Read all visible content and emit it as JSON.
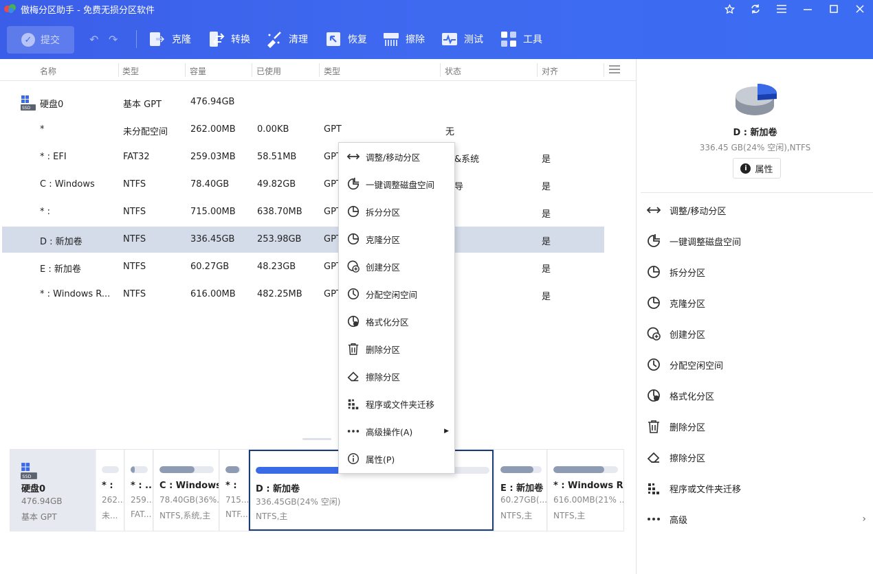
{
  "app": {
    "title": "傲梅分区助手 - 免费无损分区软件"
  },
  "window_buttons": [
    "star-icon",
    "refresh-icon",
    "menu-icon",
    "minimize-icon",
    "maximize-icon",
    "close-icon"
  ],
  "toolbar": {
    "submit_label": "提交",
    "tools": [
      {
        "label": "克隆",
        "icon": "clone-icon"
      },
      {
        "label": "转换",
        "icon": "convert-icon"
      },
      {
        "label": "清理",
        "icon": "clean-icon"
      },
      {
        "label": "恢复",
        "icon": "recover-icon"
      },
      {
        "label": "擦除",
        "icon": "wipe-icon"
      },
      {
        "label": "测试",
        "icon": "test-icon"
      },
      {
        "label": "工具",
        "icon": "tools-icon"
      }
    ]
  },
  "table": {
    "headers": [
      "名称",
      "类型",
      "容量",
      "已使用",
      "类型",
      "状态",
      "对齐"
    ],
    "rows": [
      {
        "name": "硬盘0",
        "type": "基本 GPT",
        "capacity": "476.94GB",
        "used": "",
        "ptype": "",
        "status": "",
        "align": "",
        "is_disk": true
      },
      {
        "name": "*",
        "type": "未分配空间",
        "capacity": "262.00MB",
        "used": "0.00KB",
        "ptype": "GPT",
        "status": "无",
        "align": ""
      },
      {
        "name": "* : EFI",
        "type": "FAT32",
        "capacity": "259.03MB",
        "used": "58.51MB",
        "ptype": "GPT",
        "status": "动&系统",
        "align": "是"
      },
      {
        "name": "C : Windows",
        "type": "NTFS",
        "capacity": "78.40GB",
        "used": "49.82GB",
        "ptype": "GPT",
        "status": "导",
        "align": "是"
      },
      {
        "name": "* :",
        "type": "NTFS",
        "capacity": "715.00MB",
        "used": "638.70MB",
        "ptype": "GPT",
        "status": "",
        "align": "是"
      },
      {
        "name": "D : 新加卷",
        "type": "NTFS",
        "capacity": "336.45GB",
        "used": "253.98GB",
        "ptype": "GPT",
        "status": "",
        "align": "是",
        "selected": true
      },
      {
        "name": "E : 新加卷",
        "type": "NTFS",
        "capacity": "60.27GB",
        "used": "48.23GB",
        "ptype": "GPT",
        "status": "",
        "align": "是"
      },
      {
        "name": "* : Windows R...",
        "type": "NTFS",
        "capacity": "616.00MB",
        "used": "482.25MB",
        "ptype": "GPT",
        "status": "",
        "align": "是"
      }
    ]
  },
  "context_menu": {
    "items": [
      {
        "label": "调整/移动分区",
        "icon": "resize-move-icon"
      },
      {
        "label": "一键调整磁盘空间",
        "icon": "quick-adjust-icon"
      },
      {
        "label": "拆分分区",
        "icon": "split-icon"
      },
      {
        "label": "克隆分区",
        "icon": "clone-partition-icon"
      },
      {
        "label": "创建分区",
        "icon": "create-partition-icon"
      },
      {
        "label": "分配空闲空间",
        "icon": "allocate-space-icon"
      },
      {
        "label": "格式化分区",
        "icon": "format-icon"
      },
      {
        "label": "删除分区",
        "icon": "delete-icon"
      },
      {
        "label": "擦除分区",
        "icon": "erase-icon"
      },
      {
        "label": "程序或文件夹迁移",
        "icon": "migrate-icon"
      },
      {
        "label": "高级操作(A)",
        "icon": "more-icon",
        "submenu": true
      },
      {
        "label": "属性(P)",
        "icon": "info-icon"
      }
    ]
  },
  "disk_map": {
    "disk": {
      "name": "硬盘0",
      "size": "476.94GB",
      "type": "基本 GPT"
    },
    "partitions": [
      {
        "name": "* :",
        "size": "262...",
        "fs": "未...",
        "used_fraction": 0.0
      },
      {
        "name": "* : ...",
        "size": "259...",
        "fs": "FAT...",
        "used_fraction": 0.23
      },
      {
        "name": "C : Windows",
        "size": "78.40GB(36%...",
        "fs": "NTFS,系统,主",
        "used_fraction": 0.64
      },
      {
        "name": "* :",
        "size": "715...",
        "fs": "NTF...",
        "used_fraction": 0.89
      },
      {
        "name": "D : 新加卷",
        "size": "336.45GB(24% 空闲)",
        "fs": "NTFS,主",
        "used_fraction": 0.75,
        "selected": true
      },
      {
        "name": "E : 新加卷",
        "size": "60.27GB(...",
        "fs": "NTFS,主",
        "used_fraction": 0.8
      },
      {
        "name": "* : Windows RE...",
        "size": "616.00MB(21% ...",
        "fs": "NTFS,主",
        "used_fraction": 0.79
      }
    ]
  },
  "right_panel": {
    "name": "D : 新加卷",
    "info": "336.45 GB(24% 空闲),NTFS",
    "props_label": "属性",
    "actions": [
      {
        "label": "调整/移动分区",
        "icon": "resize-move-icon"
      },
      {
        "label": "一键调整磁盘空间",
        "icon": "quick-adjust-icon"
      },
      {
        "label": "拆分分区",
        "icon": "split-icon"
      },
      {
        "label": "克隆分区",
        "icon": "clone-partition-icon"
      },
      {
        "label": "创建分区",
        "icon": "create-partition-icon"
      },
      {
        "label": "分配空闲空间",
        "icon": "allocate-space-icon"
      },
      {
        "label": "格式化分区",
        "icon": "format-icon"
      },
      {
        "label": "删除分区",
        "icon": "delete-icon"
      },
      {
        "label": "擦除分区",
        "icon": "erase-icon"
      },
      {
        "label": "程序或文件夹迁移",
        "icon": "migrate-icon"
      },
      {
        "label": "高级",
        "icon": "more-icon",
        "submenu": true
      }
    ]
  },
  "colors": {
    "accent": "#3e6af0",
    "selected_row": "#d4dcea",
    "used_bar": "#8d9bb3",
    "selected_bar": "#3a6ae6"
  }
}
